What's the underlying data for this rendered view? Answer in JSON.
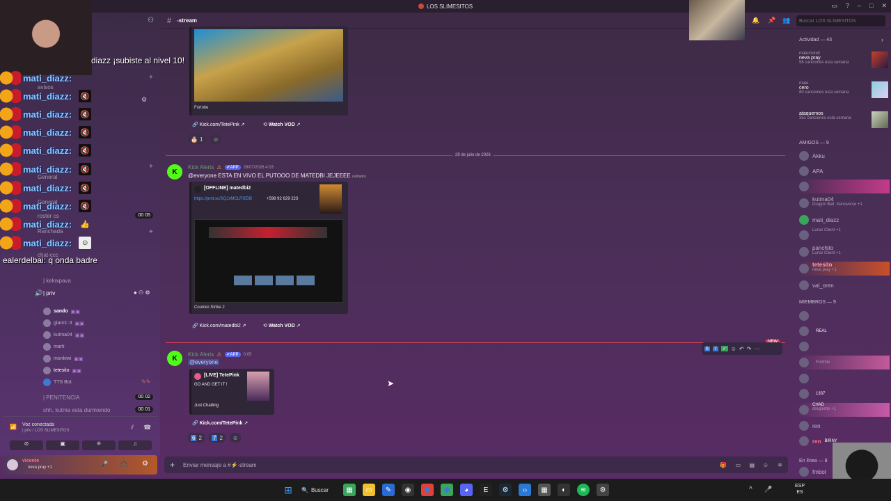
{
  "window": {
    "title": "LOS SLIMESITOS"
  },
  "overlay": {
    "level_up": "diazz ¡subiste al nivel 10!",
    "chat_names": [
      "mati_diazz:",
      "mati_diazz:",
      "mati_diazz:",
      "mati_diazz:",
      "mati_diazz:",
      "mati_diazz:",
      "mati_diazz:",
      "mati_diazz:",
      "mati_diazz:",
      "mati_diazz:"
    ],
    "last_message": "ealerdelbai: q onda badre"
  },
  "sidebar": {
    "channels": [
      {
        "label": "avisos"
      },
      {
        "label": "General"
      },
      {
        "label": "General"
      },
      {
        "label": "roster cs"
      },
      {
        "label": "Ranchada"
      },
      {
        "label": "chat-ccc"
      }
    ],
    "voice_channels": [
      {
        "label": "| kekwpava"
      },
      {
        "label": "| priv"
      }
    ],
    "voice_users": [
      {
        "name": "sando"
      },
      {
        "name": "gianni :3"
      },
      {
        "name": "kutma04"
      },
      {
        "name": "marti"
      },
      {
        "name": "monkiwi"
      },
      {
        "name": "tetesito"
      },
      {
        "name": "TTS Bot"
      }
    ],
    "penitencia": {
      "label": "| PENITENCIA",
      "a": "00",
      "b": "02"
    },
    "sleeping": {
      "label": "shh, kutma esta durmiendo",
      "a": "00",
      "b": "01"
    },
    "roster_pill": {
      "a": "00",
      "b": "05"
    },
    "voice_status": {
      "title": "Voz conectada",
      "sub": "| priv / LOS SLIMESITOS"
    },
    "user": {
      "name": "vicente",
      "status": "neva pray +1"
    }
  },
  "header": {
    "channel": "-stream",
    "search_placeholder": "Buscar LOS SLIMESITOS"
  },
  "messages": {
    "m1": {
      "embed_game": "Fortnite",
      "link": "Kick.com/TetePink",
      "vod": "Watch VOD",
      "reaction_count": "1"
    },
    "date_divider": "29 de julio de 2026",
    "m2": {
      "author": "Kick Alerts",
      "badge": "✔APP",
      "time": "29/07/2026 4:03",
      "text": "@everyone ESTA EN VIVO EL PUTOOO DE MATEDBI JEJEEEE",
      "edited": "(editado)",
      "embed_title": "[OFFLINE] matedbi2",
      "embed_link": "https://prnt.sc/SQJxMCLRSEIB",
      "embed_phone": "+598 92 629 223",
      "embed_game": "Counter-Strike 2",
      "link": "Kick.com/matedbi2",
      "vod": "Watch VOD"
    },
    "m3": {
      "author": "Kick Alerts",
      "badge": "✔APP",
      "time": "0:05",
      "text": "@everyone",
      "embed_title": "[LIVE] TetePink",
      "embed_desc": "GO AND GET IT !",
      "embed_game": "Just Chatting",
      "link": "Kick.com/TetePink",
      "reactions": [
        {
          "emoji": "6",
          "count": "2"
        },
        {
          "emoji": "7",
          "count": "2"
        }
      ]
    },
    "new_badge": "NEW"
  },
  "composer": {
    "placeholder": "Enviar mensaje a #⚡-stream"
  },
  "right": {
    "activity_title": "Actividad — 43",
    "activities": [
      {
        "name": "matumorell",
        "title": "neva pray",
        "sub": "58 canciones esta semana"
      },
      {
        "name": "mate",
        "title": "cero",
        "sub": "80 canciones esta semana"
      },
      {
        "name": "",
        "title": "ataquemos",
        "sub": "351 canciones esta semana"
      }
    ],
    "friends_title": "AMIGOS — 9",
    "friends": [
      {
        "name": "Akku",
        "sub": ""
      },
      {
        "name": "APA",
        "sub": ""
      },
      {
        "name": "",
        "sub": ""
      },
      {
        "name": "kutma04",
        "sub": "Dragon Ball: Xenoverse +1"
      },
      {
        "name": "mati_diazz",
        "sub": ""
      },
      {
        "name": "",
        "sub": "Lunar Client +1"
      },
      {
        "name": "panchito",
        "sub": "Lunar Client +1"
      },
      {
        "name": "tetesito",
        "sub": "neva pray +1"
      },
      {
        "name": "val_oren",
        "sub": ""
      }
    ],
    "members_title": "MIEMBROS — 9",
    "members": [
      {
        "name": "",
        "sub": ""
      },
      {
        "name": "",
        "sub": "REAL"
      },
      {
        "name": "",
        "sub": ""
      },
      {
        "name": "",
        "sub": "Fortnite"
      },
      {
        "name": "",
        "sub": ""
      },
      {
        "name": "",
        "sub": "1337"
      },
      {
        "name": "",
        "sub": "CHAD"
      },
      {
        "name": "",
        "sub": "dregnette +1"
      },
      {
        "name": "ren",
        "sub": "BIRNY"
      }
    ],
    "online_title": "En línea — 8",
    "online": [
      {
        "name": "fmbot"
      }
    ]
  },
  "taskbar": {
    "search": "Buscar",
    "lang": "ESP",
    "lang_sub": "ES"
  },
  "colors": {
    "accent": "#5865f2",
    "kick_green": "#53fc18",
    "mention": "#c9cdfb"
  }
}
